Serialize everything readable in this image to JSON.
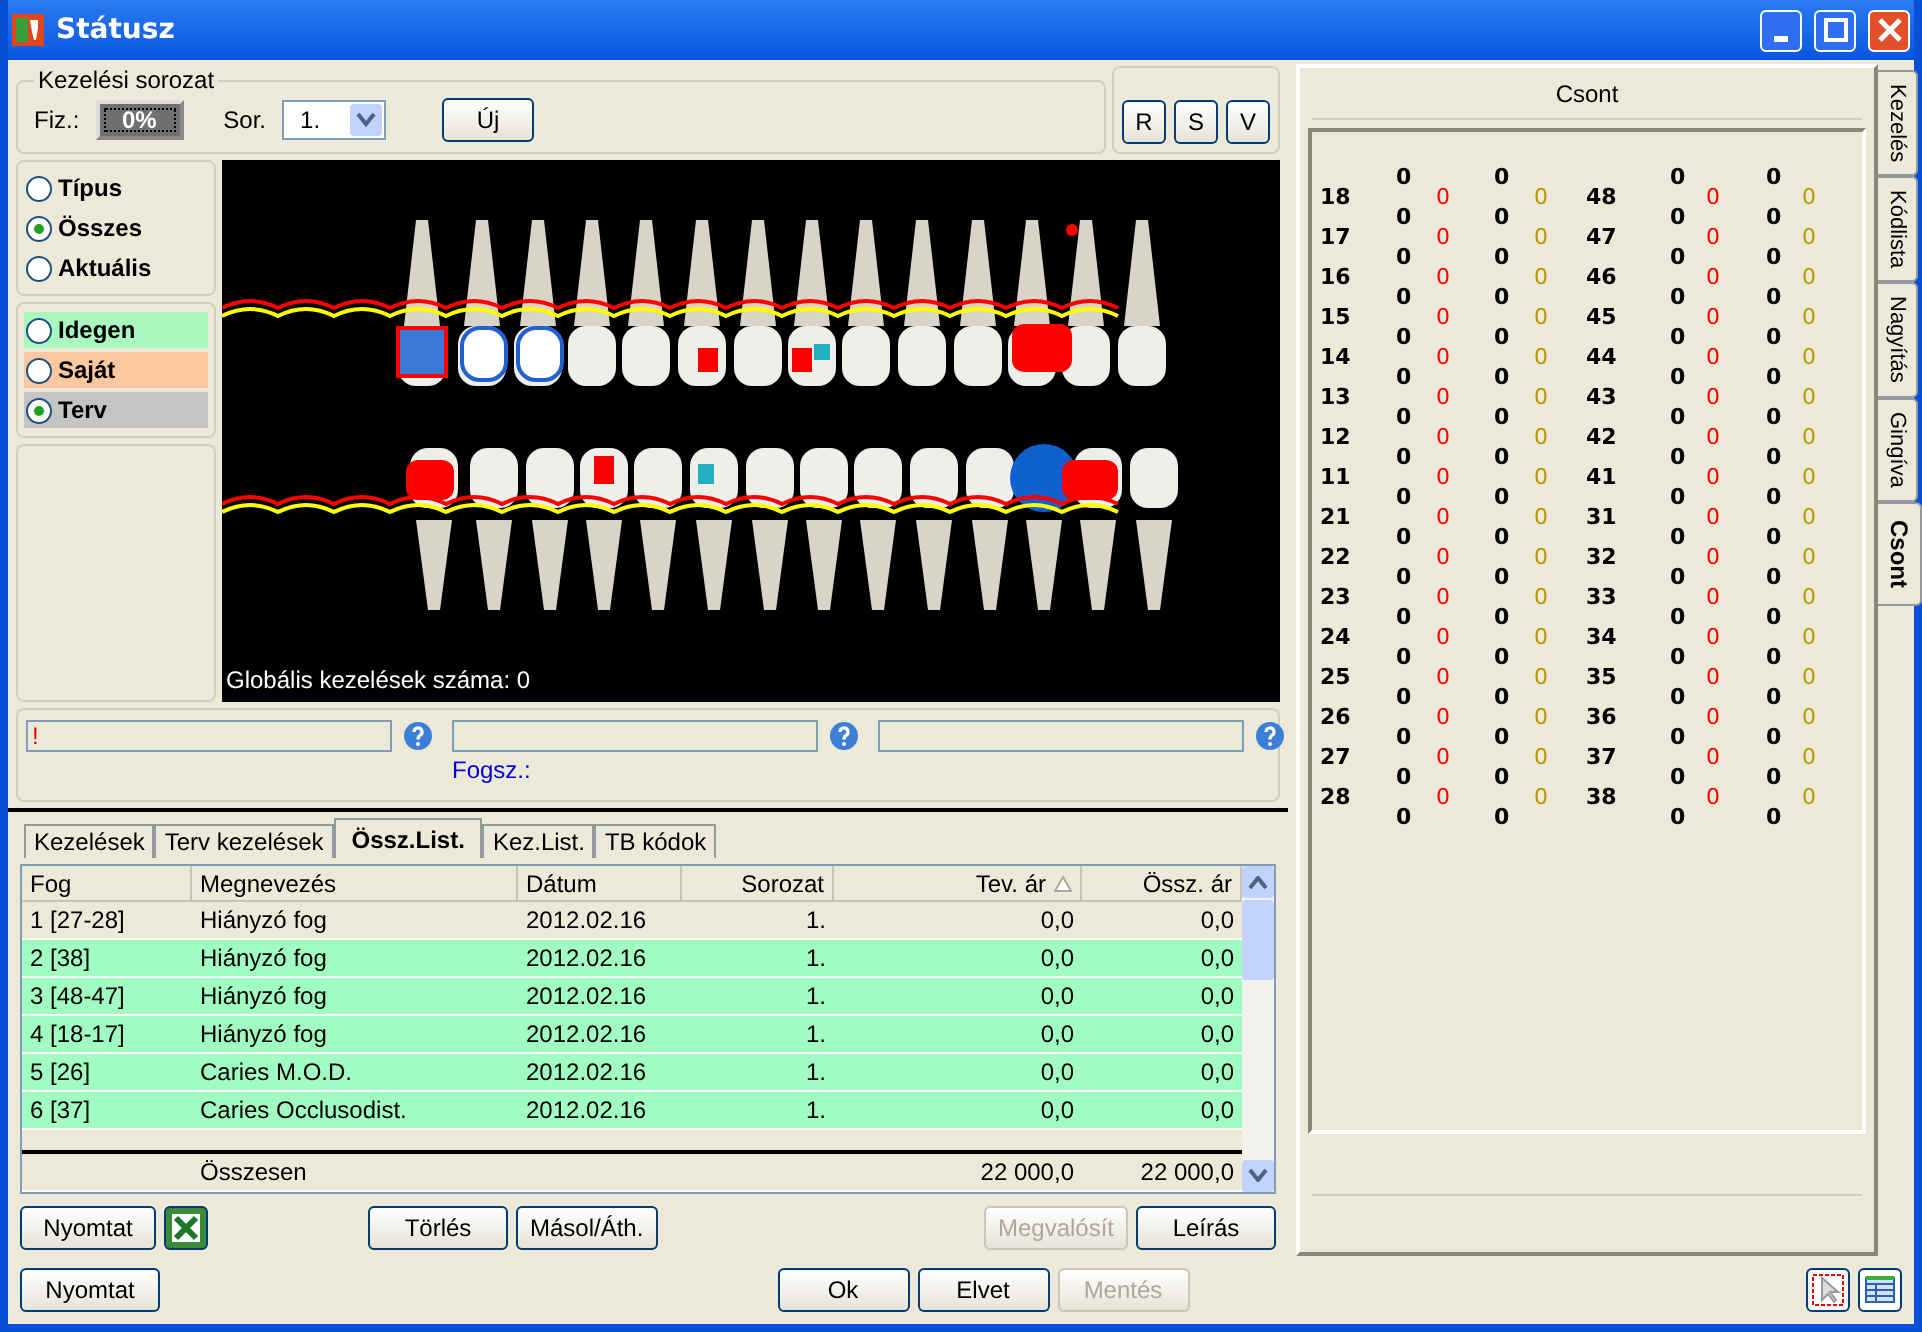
{
  "window": {
    "title": "Státusz"
  },
  "series_group": {
    "label": "Kezelési sorozat",
    "pay_label": "Fiz.:",
    "pay_value": "0%",
    "series_label": "Sor.",
    "series_value": "1.",
    "new_button": "Új"
  },
  "view_buttons": [
    "R",
    "S",
    "V"
  ],
  "filter_options": [
    {
      "label": "Típus",
      "selected": false
    },
    {
      "label": "Összes",
      "selected": true
    },
    {
      "label": "Aktuális",
      "selected": false
    }
  ],
  "source_options": [
    {
      "label": "Idegen",
      "selected": false,
      "color": "#a8f8c0"
    },
    {
      "label": "Saját",
      "selected": false,
      "color": "#fcc8a0"
    },
    {
      "label": "Terv",
      "selected": true,
      "color": "#c4c4c4"
    }
  ],
  "dental_chart": {
    "caption": "Globális kezelések száma: 0"
  },
  "note_field": {
    "value": "!"
  },
  "tooth_label": "Fogsz.:",
  "tabs": [
    {
      "label": "Kezelések",
      "selected": false
    },
    {
      "label": "Terv kezelések",
      "selected": false
    },
    {
      "label": "Össz.List.",
      "selected": true
    },
    {
      "label": "Kez.List.",
      "selected": false
    },
    {
      "label": "TB kódok",
      "selected": false
    }
  ],
  "table": {
    "columns": [
      {
        "label": "Fog",
        "kind": "text",
        "sorted": false
      },
      {
        "label": "Megnevezés",
        "kind": "text",
        "sorted": false
      },
      {
        "label": "Dátum",
        "kind": "text",
        "sorted": false
      },
      {
        "label": "Sorozat",
        "kind": "number",
        "sorted": false
      },
      {
        "label": "Tev. ár",
        "kind": "number",
        "sorted": true
      },
      {
        "label": "Össz. ár",
        "kind": "number",
        "sorted": false
      }
    ],
    "rows": [
      {
        "color": "#ece9d8",
        "cells": [
          "1 [27-28]",
          "Hiányzó fog",
          "2012.02.16",
          "1.",
          "0,0",
          "0,0"
        ]
      },
      {
        "color": "#a0fcc0",
        "cells": [
          "2 [38]",
          "Hiányzó fog",
          "2012.02.16",
          "1.",
          "0,0",
          "0,0"
        ]
      },
      {
        "color": "#a0fcc0",
        "cells": [
          "3 [48-47]",
          "Hiányzó fog",
          "2012.02.16",
          "1.",
          "0,0",
          "0,0"
        ]
      },
      {
        "color": "#a0fcc0",
        "cells": [
          "4 [18-17]",
          "Hiányzó fog",
          "2012.02.16",
          "1.",
          "0,0",
          "0,0"
        ]
      },
      {
        "color": "#a0fcc0",
        "cells": [
          "5 [26]",
          "Caries M.O.D.",
          "2012.02.16",
          "1.",
          "0,0",
          "0,0"
        ]
      },
      {
        "color": "#a0fcc0",
        "cells": [
          "6 [37]",
          "Caries Occlusodist.",
          "2012.02.16",
          "1.",
          "0,0",
          "0,0"
        ]
      }
    ],
    "total": {
      "label": "Összesen",
      "values": [
        "22 000,0",
        "22 000,0"
      ]
    }
  },
  "table_buttons": {
    "left": [
      {
        "label": "Nyomtat",
        "disabled": false
      }
    ],
    "middle": [
      {
        "label": "Törlés",
        "disabled": false
      },
      {
        "label": "Másol/Áth.",
        "disabled": false
      }
    ],
    "right": [
      {
        "label": "Megvalósít",
        "disabled": true
      },
      {
        "label": "Leírás",
        "disabled": false
      }
    ]
  },
  "footer_buttons": {
    "left": [
      {
        "label": "Nyomtat",
        "disabled": false
      }
    ],
    "center": [
      {
        "label": "Ok",
        "disabled": false
      },
      {
        "label": "Elvet",
        "disabled": false
      },
      {
        "label": "Mentés",
        "disabled": true
      }
    ]
  },
  "side_tabs": [
    {
      "label": "Kezelés",
      "selected": false
    },
    {
      "label": "Kódlista",
      "selected": false
    },
    {
      "label": "Nagyítás",
      "selected": false
    },
    {
      "label": "Gingíva",
      "selected": false
    },
    {
      "label": "Csont",
      "selected": true
    }
  ],
  "bone": {
    "title": "Csont",
    "columns": [
      {
        "kind": "tooth",
        "values": [
          "18",
          "17",
          "16",
          "15",
          "14",
          "13",
          "12",
          "11",
          "21",
          "22",
          "23",
          "24",
          "25",
          "26",
          "27",
          "28"
        ]
      },
      {
        "kind": "offset",
        "values": [
          "0",
          "0",
          "0",
          "0",
          "0",
          "0",
          "0",
          "0",
          "0",
          "0",
          "0",
          "0",
          "0",
          "0",
          "0",
          "0",
          "0"
        ]
      },
      {
        "kind": "value",
        "color": "#ff0000",
        "values": [
          "0",
          "0",
          "0",
          "0",
          "0",
          "0",
          "0",
          "0",
          "0",
          "0",
          "0",
          "0",
          "0",
          "0",
          "0",
          "0"
        ]
      },
      {
        "kind": "offset",
        "values": [
          "0",
          "0",
          "0",
          "0",
          "0",
          "0",
          "0",
          "0",
          "0",
          "0",
          "0",
          "0",
          "0",
          "0",
          "0",
          "0",
          "0"
        ]
      },
      {
        "kind": "value",
        "color": "#b89a00",
        "values": [
          "0",
          "0",
          "0",
          "0",
          "0",
          "0",
          "0",
          "0",
          "0",
          "0",
          "0",
          "0",
          "0",
          "0",
          "0",
          "0"
        ]
      },
      {
        "kind": "tooth",
        "values": [
          "48",
          "47",
          "46",
          "45",
          "44",
          "43",
          "42",
          "41",
          "31",
          "32",
          "33",
          "34",
          "35",
          "36",
          "37",
          "38"
        ]
      },
      {
        "kind": "offset",
        "values": [
          "0",
          "0",
          "0",
          "0",
          "0",
          "0",
          "0",
          "0",
          "0",
          "0",
          "0",
          "0",
          "0",
          "0",
          "0",
          "0",
          "0"
        ]
      },
      {
        "kind": "value",
        "color": "#ff0000",
        "values": [
          "0",
          "0",
          "0",
          "0",
          "0",
          "0",
          "0",
          "0",
          "0",
          "0",
          "0",
          "0",
          "0",
          "0",
          "0",
          "0"
        ]
      },
      {
        "kind": "offset",
        "values": [
          "0",
          "0",
          "0",
          "0",
          "0",
          "0",
          "0",
          "0",
          "0",
          "0",
          "0",
          "0",
          "0",
          "0",
          "0",
          "0",
          "0"
        ]
      },
      {
        "kind": "value",
        "color": "#b89a00",
        "values": [
          "0",
          "0",
          "0",
          "0",
          "0",
          "0",
          "0",
          "0",
          "0",
          "0",
          "0",
          "0",
          "0",
          "0",
          "0",
          "0"
        ]
      }
    ]
  }
}
